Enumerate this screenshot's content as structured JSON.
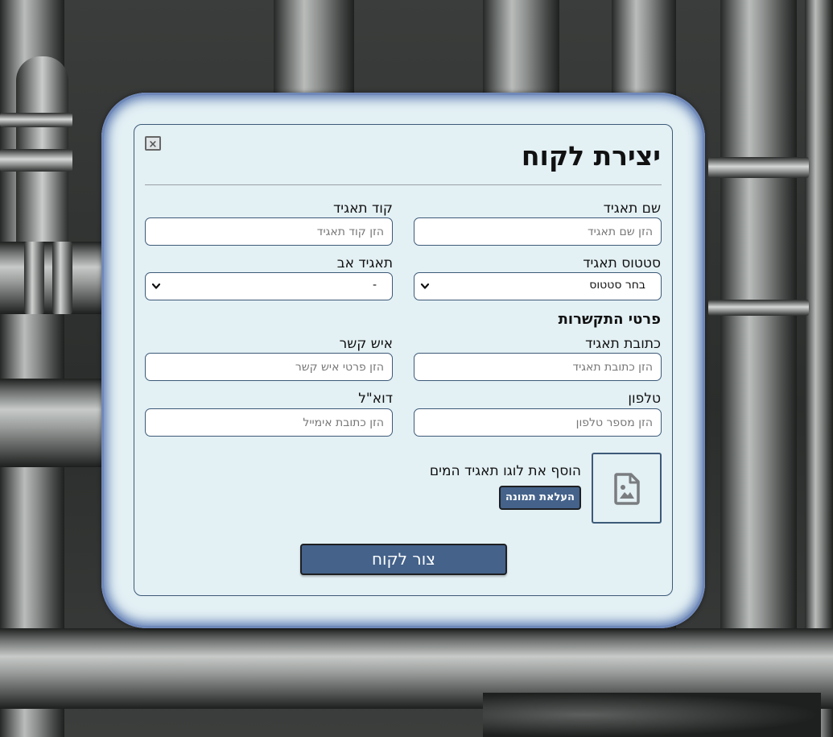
{
  "modal": {
    "title": "יצירת לקוח",
    "close_icon_glyph": "×"
  },
  "form": {
    "tag_name": {
      "label": "שם תאגיד",
      "placeholder": "הזן שם תאגיד",
      "value": ""
    },
    "tag_code": {
      "label": "קוד תאגיד",
      "placeholder": "הזן קוד תאגיד",
      "value": ""
    },
    "tag_status": {
      "label": "סטטוס תאגיד",
      "selected": "בחר סטטוס"
    },
    "parent_tag": {
      "label": "תאגיד אב",
      "selected": "-"
    }
  },
  "contact": {
    "section_title": "פרטי התקשרות",
    "address": {
      "label": "כתובת תאגיד",
      "placeholder": "הזן כתובת תאגיד",
      "value": ""
    },
    "contact_person": {
      "label": "איש קשר",
      "placeholder": "הזן פרטי איש קשר",
      "value": ""
    },
    "phone": {
      "label": "טלפון",
      "placeholder": "הזן מספר טלפון",
      "value": ""
    },
    "email": {
      "label": "דוא\"ל",
      "placeholder": "הזן כתובת אימייל",
      "value": ""
    }
  },
  "logo": {
    "text": "הוסף את לוגו תאגיד המים",
    "upload_label": "העלאת תמונה",
    "icon": "image-file-icon"
  },
  "actions": {
    "submit_label": "צור לקוח"
  },
  "colors": {
    "modal_bg": "#e3f0f4",
    "accent_border": "#3d5a78",
    "button_bg": "#44628a",
    "glow": "#5a78b0"
  }
}
